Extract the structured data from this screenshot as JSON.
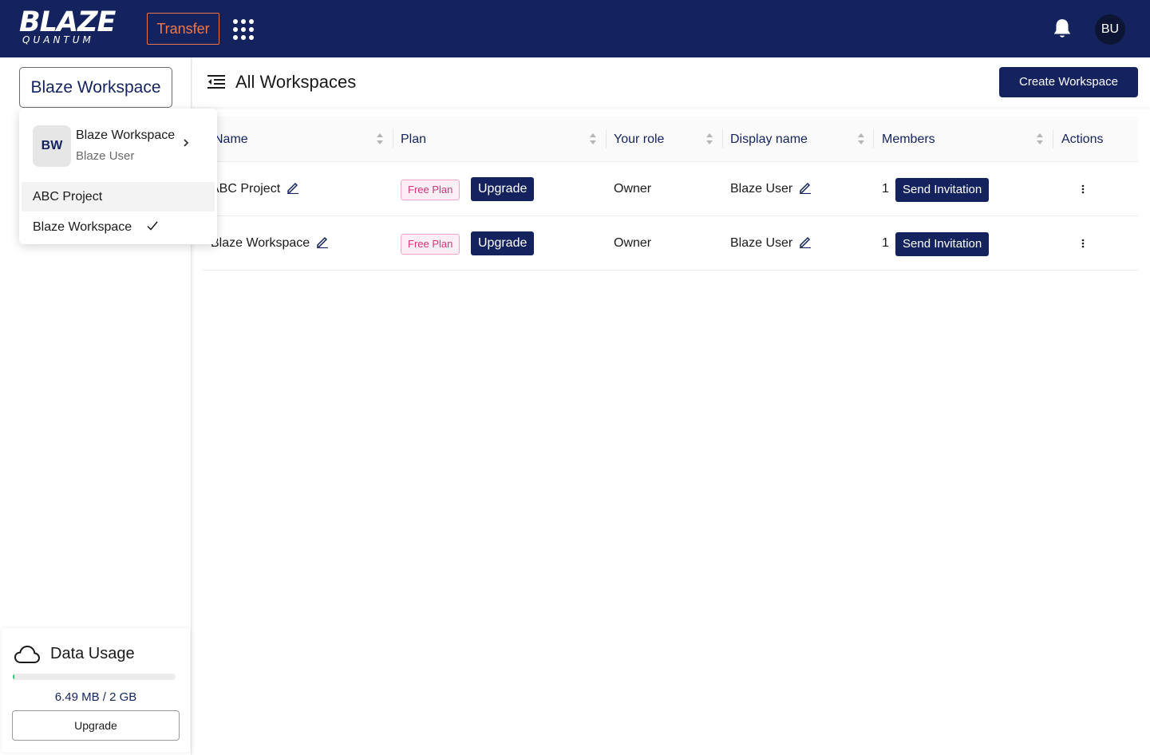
{
  "topbar": {
    "logo_main": "BLAZE",
    "logo_sub": "QUANTUM",
    "transfer_label": "Transfer",
    "avatar_initials": "BU"
  },
  "sidebar": {
    "workspace_selector": "Blaze Workspace",
    "usage": {
      "title": "Data Usage",
      "text": "6.49 MB / 2 GB",
      "fraction": 0.0032,
      "upgrade_label": "Upgrade"
    }
  },
  "dropdown": {
    "avatar": "BW",
    "workspace_name": "Blaze Workspace",
    "user_name": "Blaze User",
    "items": [
      {
        "label": "ABC Project",
        "selected": false
      },
      {
        "label": "Blaze Workspace",
        "selected": true
      }
    ]
  },
  "header": {
    "title": "All Workspaces",
    "create_label": "Create Workspace"
  },
  "table": {
    "columns": [
      "Name",
      "Plan",
      "Your role",
      "Display name",
      "Members",
      "Actions"
    ],
    "rows": [
      {
        "name": "ABC Project",
        "plan": "Free Plan",
        "upgrade": "Upgrade",
        "role": "Owner",
        "display_name": "Blaze User",
        "members": "1",
        "invite": "Send Invitation"
      },
      {
        "name": "Blaze Workspace",
        "plan": "Free Plan",
        "upgrade": "Upgrade",
        "role": "Owner",
        "display_name": "Blaze User",
        "members": "1",
        "invite": "Send Invitation"
      }
    ]
  },
  "colors": {
    "brand_navy": "#14235e",
    "transfer_orange": "#f0784a",
    "free_plan_pink": "#d1377a",
    "usage_green": "#2ec27e"
  },
  "icons": [
    "apps-grid-icon",
    "bell-icon",
    "menu-collapse-icon",
    "sort-icon",
    "edit-icon",
    "more-vertical-icon",
    "cloud-icon",
    "chevron-right-icon",
    "check-icon"
  ]
}
